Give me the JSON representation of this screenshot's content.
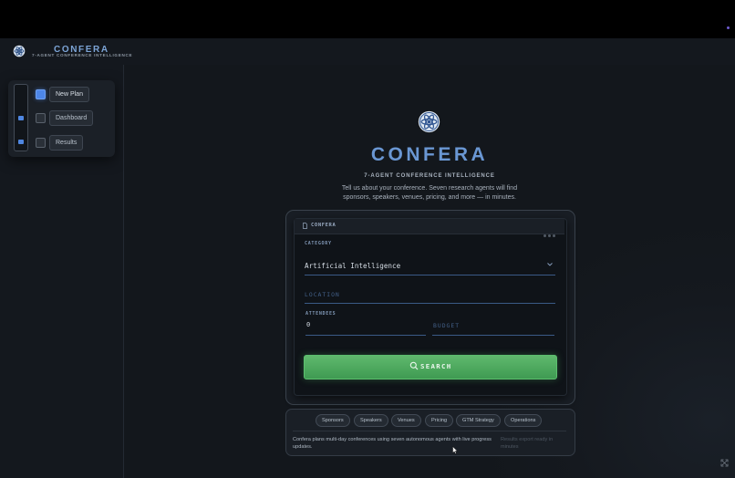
{
  "brand": {
    "title": "CONFERA",
    "subtitle": "7-AGENT CONFERENCE INTELLIGENCE",
    "logo_icon": "atom-logo-icon"
  },
  "nav": {
    "items": [
      {
        "label": "New Plan",
        "checked": true
      },
      {
        "label": "Dashboard",
        "checked": false
      },
      {
        "label": "Results",
        "checked": false
      }
    ]
  },
  "hero": {
    "title": "CONFERA",
    "subtitle": "7-AGENT CONFERENCE INTELLIGENCE",
    "description": "Tell us about your conference. Seven research agents will find sponsors, speakers, venues, pricing, and more — in minutes."
  },
  "form": {
    "header_title": "CONFERA",
    "category_label": "CATEGORY",
    "category_value": "Artificial Intelligence",
    "location_placeholder": "LOCATION",
    "attendees_label": "ATTENDEES",
    "attendees_value": "0",
    "budget_placeholder": "BUDGET",
    "search_label": "SEARCH"
  },
  "info": {
    "chips": [
      "Sponsors",
      "Speakers",
      "Venues",
      "Pricing",
      "GTM Strategy",
      "Operations"
    ],
    "text": "Confera plans multi-day conferences using seven autonomous agents with live progress updates.",
    "note": "Results export ready in minutes"
  },
  "colors": {
    "accent": "#6a97d3",
    "search_green": "#4fab5f",
    "background": "#15191f"
  }
}
